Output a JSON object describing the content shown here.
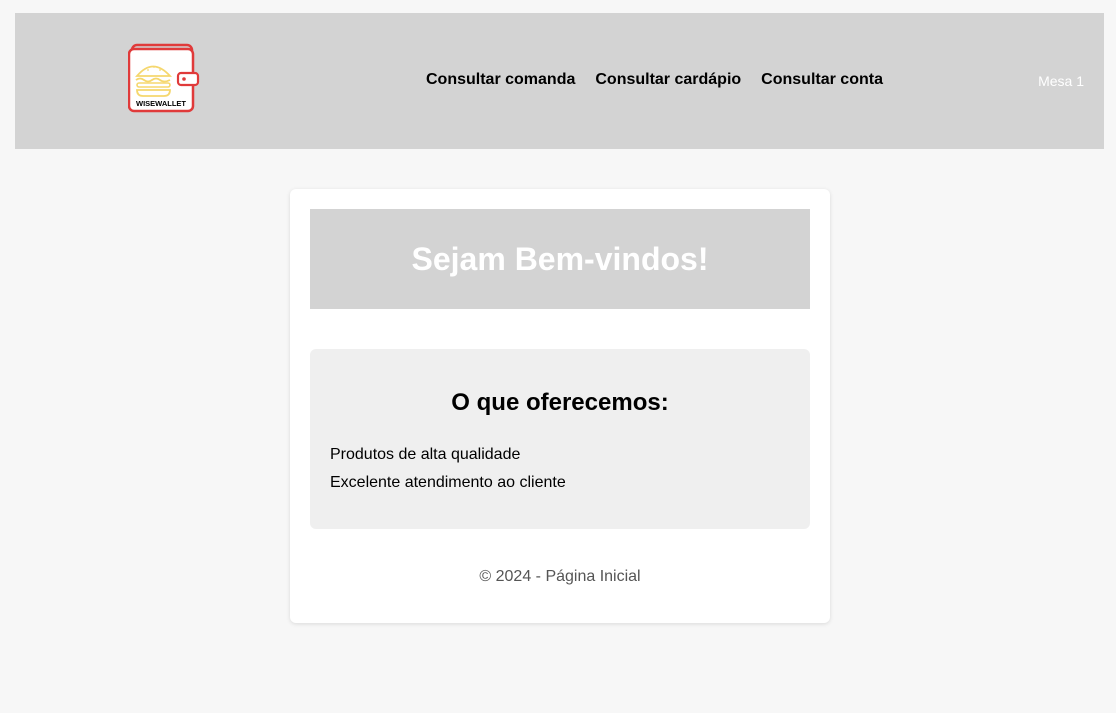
{
  "header": {
    "logo": {
      "icon": "burger-wallet-logo",
      "text": "WISEWALLET"
    },
    "nav": [
      {
        "label": "Consultar comanda"
      },
      {
        "label": "Consultar cardápio"
      },
      {
        "label": "Consultar conta"
      }
    ],
    "table_label": "Mesa 1"
  },
  "main": {
    "welcome_title": "Sejam Bem-vindos!",
    "offers": {
      "title": "O que oferecemos:",
      "items": [
        "Produtos de alta qualidade",
        "Excelente atendimento ao cliente"
      ]
    },
    "footer": "© 2024 - Página Inicial"
  },
  "colors": {
    "header_bg": "#d3d3d3",
    "page_bg": "#f7f7f7",
    "logo_red": "#e03a3a",
    "logo_yellow": "#f5d76e"
  }
}
